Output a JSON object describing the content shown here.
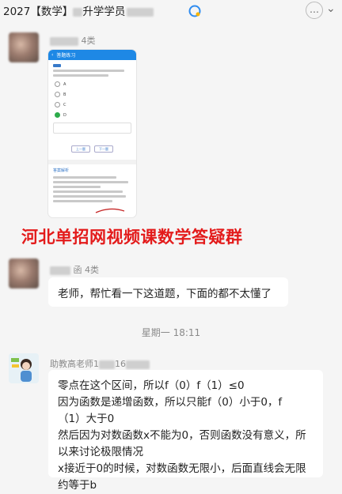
{
  "titlebar": {
    "title_prefix": "2027【数学】",
    "title_mid": "升学学员",
    "more_glyph": "…",
    "chevron_glyph": "⌄"
  },
  "messages": [
    {
      "sender_suffix": "4类"
    },
    {
      "sender_suffix": "函 4类",
      "text": "老师，帮忙看一下这道题，下面的都不太懂了"
    }
  ],
  "timestamp": "星期一 18:11",
  "teacher": {
    "sender_prefix": "助教高老师1",
    "sender_mid": "16",
    "lines": [
      "零点在这个区间，所以f（0）f（1）≤0",
      "因为函数是递增函数，所以只能f（0）小于0，f",
      "（1）大于0",
      "然后因为对数函数x不能为0，否则函数没有意义，所",
      "以来讨论极限情况",
      "x接近于0的时候，对数函数无限小，后面直线会无限",
      "约等于b"
    ]
  },
  "overlay": "河北单招网视频课数学答疑群",
  "colors": {
    "overlay_red": "#e31b1b",
    "phone_blue": "#1e88e5",
    "correct_green": "#2dab4a"
  },
  "phone_screenshot": {
    "header": "答题练习",
    "options": [
      "A",
      "B",
      "C",
      "D"
    ],
    "prev_label": "上一题",
    "next_label": "下一题",
    "section_label": "答案解析"
  }
}
